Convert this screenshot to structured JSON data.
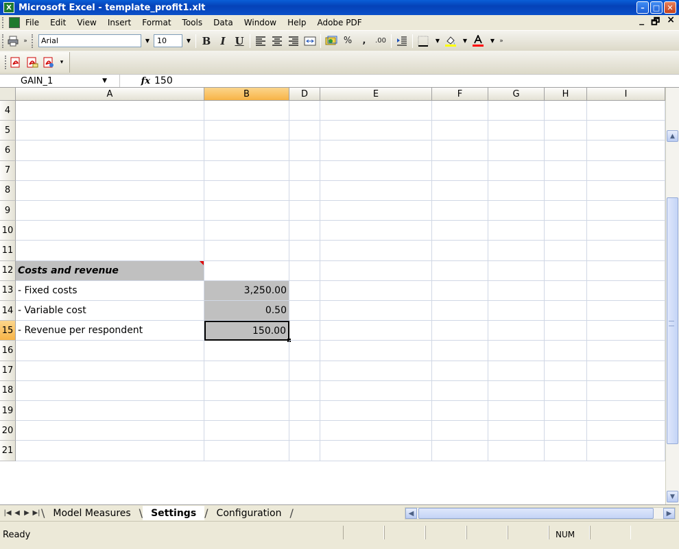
{
  "window": {
    "title": "Microsoft Excel - template_profit1.xlt",
    "minimize": "–",
    "maximize": "□",
    "close": "✕"
  },
  "menubar": {
    "items": [
      "File",
      "Edit",
      "View",
      "Insert",
      "Format",
      "Tools",
      "Data",
      "Window",
      "Help",
      "Adobe PDF"
    ],
    "doc_min": "_",
    "doc_restore": "🗗",
    "doc_close": "×"
  },
  "toolbar": {
    "font_name": "Arial",
    "font_size": "10",
    "bold": "B",
    "italic": "I",
    "underline": "U",
    "percent": "%",
    "comma": ",",
    "decimals": ".00"
  },
  "formula_bar": {
    "name_box": "GAIN_1",
    "fx": "fx",
    "formula": "150"
  },
  "columns": [
    "A",
    "B",
    "D",
    "E",
    "F",
    "G",
    "H",
    "I"
  ],
  "selected_column": "B",
  "rows": [
    {
      "num": "4",
      "a": "",
      "b": ""
    },
    {
      "num": "5",
      "a": "",
      "b": ""
    },
    {
      "num": "6",
      "a": "",
      "b": ""
    },
    {
      "num": "7",
      "a": "",
      "b": ""
    },
    {
      "num": "8",
      "a": "",
      "b": ""
    },
    {
      "num": "9",
      "a": "",
      "b": ""
    },
    {
      "num": "10",
      "a": "",
      "b": ""
    },
    {
      "num": "11",
      "a": "",
      "b": ""
    },
    {
      "num": "12",
      "a": "Costs and revenue",
      "b": ""
    },
    {
      "num": "13",
      "a": "- Fixed costs",
      "b": "3,250.00"
    },
    {
      "num": "14",
      "a": "- Variable cost",
      "b": "0.50"
    },
    {
      "num": "15",
      "a": "- Revenue per respondent",
      "b": "150.00"
    },
    {
      "num": "16",
      "a": "",
      "b": ""
    },
    {
      "num": "17",
      "a": "",
      "b": ""
    },
    {
      "num": "18",
      "a": "",
      "b": ""
    },
    {
      "num": "19",
      "a": "",
      "b": ""
    },
    {
      "num": "20",
      "a": "",
      "b": ""
    },
    {
      "num": "21",
      "a": "",
      "b": ""
    }
  ],
  "selected_row": "15",
  "sheet_tabs": [
    "Model Measures",
    "Settings",
    "Configuration"
  ],
  "active_sheet": "Settings",
  "status": {
    "text": "Ready",
    "num": "NUM"
  },
  "colors": {
    "title_bar": "#0542b8",
    "selected_header": "#f8b447",
    "input_cell": "#c0c0c0",
    "gridline": "#d0d7e5"
  }
}
